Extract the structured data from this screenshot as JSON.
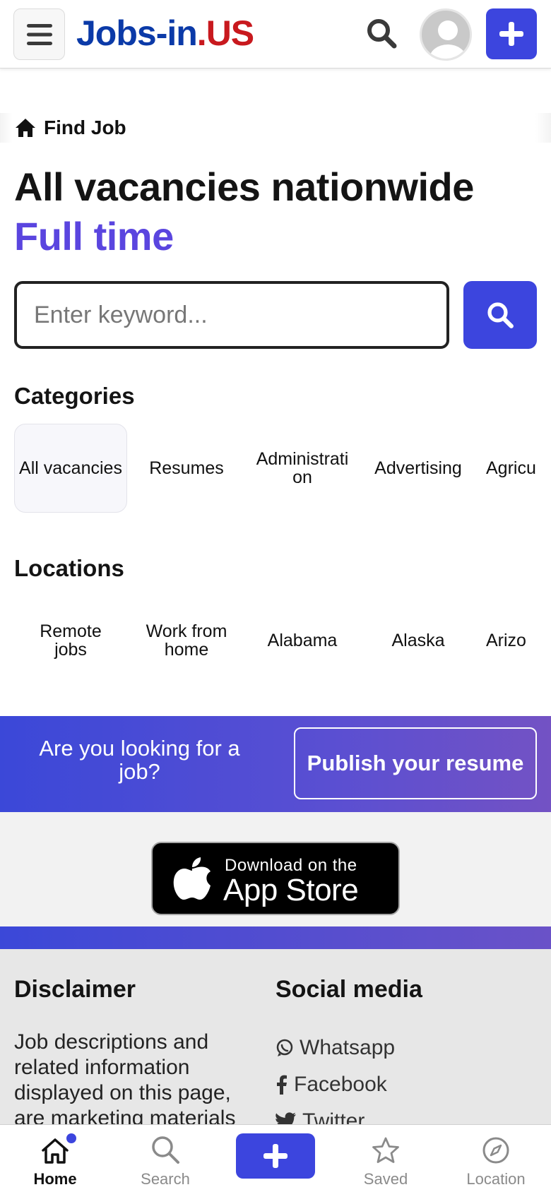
{
  "header": {
    "logo_part1": "Jobs-in",
    "logo_part2": ".US"
  },
  "breadcrumb": {
    "label": "Find Job"
  },
  "title": {
    "line1": "All vacancies nationwide",
    "line2": "Full time"
  },
  "search": {
    "placeholder": "Enter keyword..."
  },
  "categories": {
    "heading": "Categories",
    "items": [
      "All vacancies",
      "Resumes",
      "Administration",
      "Advertising",
      "Agricu"
    ]
  },
  "locations": {
    "heading": "Locations",
    "items": [
      "Remote jobs",
      "Work from home",
      "Alabama",
      "Alaska",
      "Arizo"
    ]
  },
  "banner": {
    "text": "Are you looking for a job?",
    "button": "Publish your resume"
  },
  "appstore": {
    "line1": "Download on the",
    "line2": "App Store"
  },
  "footer": {
    "disclaimer_heading": "Disclaimer",
    "disclaimer_text": "Job descriptions and related information displayed on this page, are marketing materials",
    "social_heading": "Social media",
    "social": [
      "Whatsapp",
      "Facebook",
      "Twitter"
    ]
  },
  "bottom_nav": {
    "items": [
      "Home",
      "Search",
      "Saved",
      "Location"
    ]
  },
  "colors": {
    "accent": "#3c45de",
    "title_accent": "#5a45df",
    "logo_blue": "#0b3aa8",
    "logo_red": "#c8191e"
  }
}
